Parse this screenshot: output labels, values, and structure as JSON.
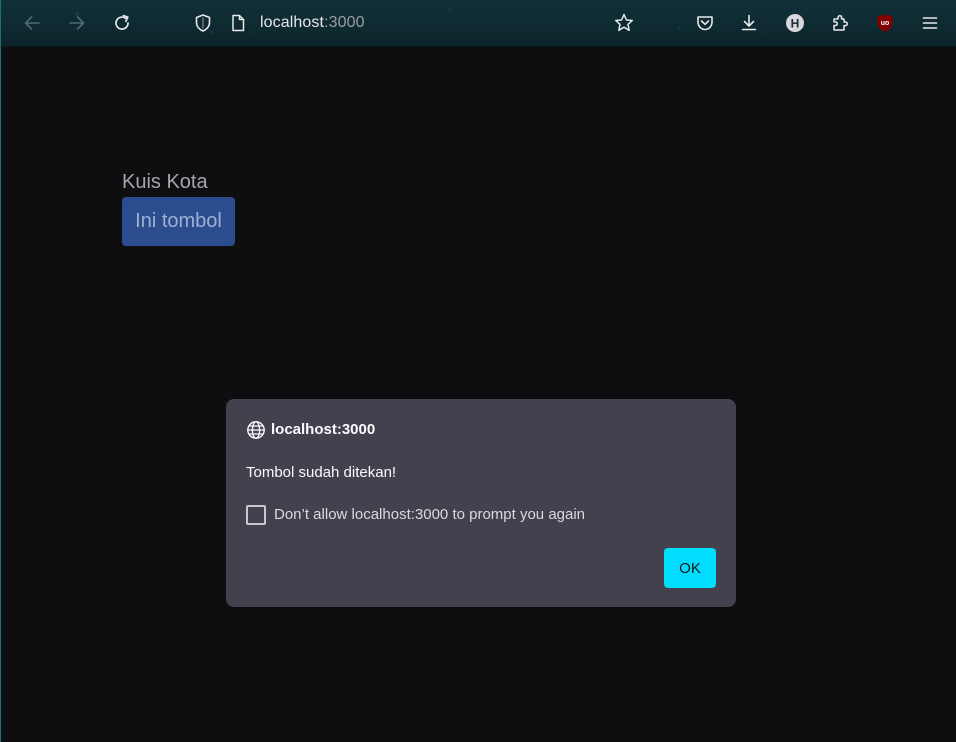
{
  "browser": {
    "url_host": "localhost",
    "url_port": ":3000",
    "icons": [
      "back-arrow-icon",
      "forward-arrow-icon",
      "reload-icon",
      "shield-icon",
      "page-icon",
      "bookmark-star-icon",
      "pocket-icon",
      "download-icon",
      "h-extension-icon",
      "extensions-puzzle-icon",
      "ublock-origin-icon",
      "menu-icon"
    ],
    "h_extension_letter": "H",
    "ublock_letters": "uo"
  },
  "page": {
    "title": "Kuis Kota",
    "button_label": "Ini tombol"
  },
  "dialog": {
    "host": "localhost:3000",
    "message": "Tombol sudah ditekan!",
    "checkbox_label": "Don’t allow localhost:3000 to prompt you again",
    "checkbox_checked": false,
    "ok_label": "OK"
  },
  "colors": {
    "page_background": "#0e0e11",
    "page_button": "#2b4d8e",
    "dialog_background": "#42414d",
    "ok_button": "#00ddff"
  }
}
